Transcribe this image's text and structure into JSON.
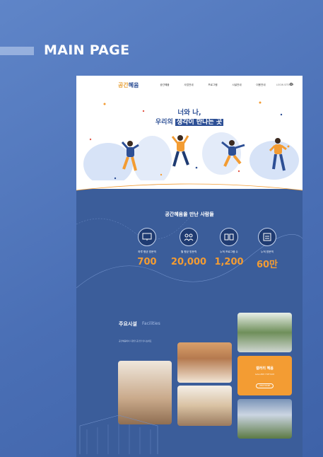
{
  "page_label": "MAIN PAGE",
  "nav": {
    "logo_prefix": "공간",
    "logo_main": "혜윰",
    "items": [
      "공간혜윰",
      "사업안내",
      "프로그램",
      "시설안내",
      "이용안내"
    ],
    "util": "LOGIN  SITEMAP"
  },
  "hero": {
    "line1": "너와 나,",
    "line2_prefix": "우리의 ",
    "line2_highlight": "생각이 만나는 곳"
  },
  "stats": {
    "title": "공간혜윰을 만난 사람들",
    "items": [
      {
        "label": "하루 평균 방문객",
        "value": "700",
        "icon": "monitor-icon"
      },
      {
        "label": "월 평균 방문객",
        "value": "20,000",
        "icon": "group-icon"
      },
      {
        "label": "누적 프로그램 수",
        "value": "1,200",
        "icon": "program-icon"
      },
      {
        "label": "누적 방문객",
        "value": "60만",
        "icon": "visitors-icon"
      }
    ]
  },
  "facilities": {
    "title": "주요시설",
    "subtitle": "Facilities",
    "description": "공간혜윰에서 다양한 공간을 만나보세요",
    "gallery_title": "갤러리 혜윰",
    "gallery_sub": "GALLERY HYEYUM",
    "gallery_button": "VIEW MORE"
  },
  "colors": {
    "navy": "#2d4f95",
    "orange": "#f39c33",
    "section_blue": "#3b5d9a"
  }
}
